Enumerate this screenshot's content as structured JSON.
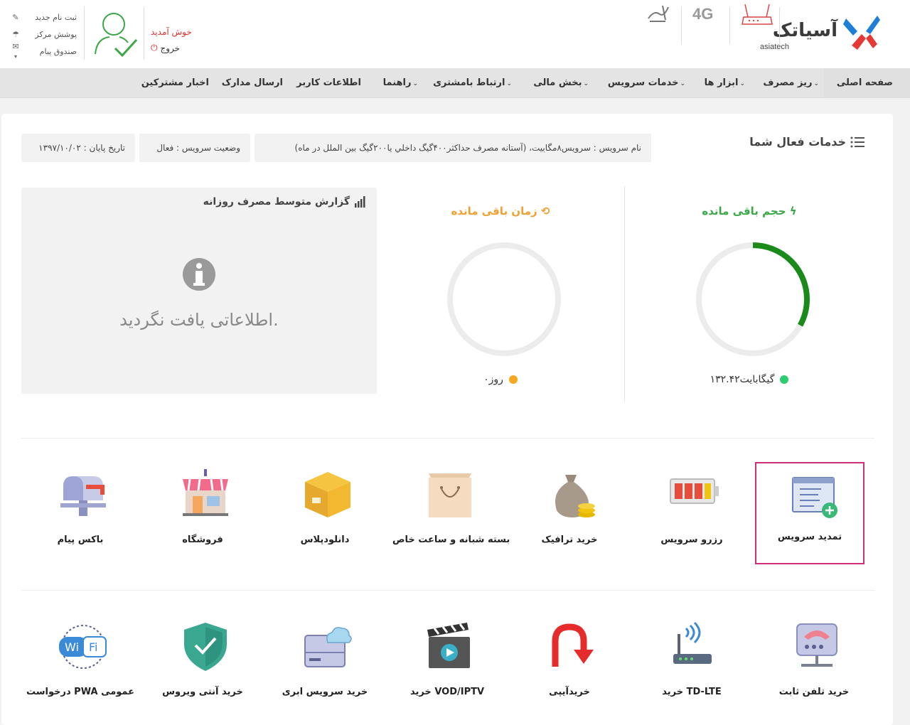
{
  "header": {
    "logo_text": "آسیاتک",
    "logo_sub": "asiatech",
    "welcome": "خوش آمدید",
    "logout": "خروج",
    "quick_links": [
      {
        "label": "ثبت نام جدید",
        "icon": "pencil-icon"
      },
      {
        "label": "پوشش مرکز",
        "icon": "umbrella-icon"
      },
      {
        "label": "صندوق پیام",
        "icon": "envelope-icon"
      }
    ],
    "badge_4g": "4G"
  },
  "nav": {
    "items": [
      {
        "label": "صفحه اصلی",
        "caret": false
      },
      {
        "label": "ریز مصرف",
        "caret": true
      },
      {
        "label": "ابزار ها",
        "caret": true
      },
      {
        "label": "خدمات سرویس",
        "caret": true
      },
      {
        "label": "بخش مالی",
        "caret": true
      },
      {
        "label": "ارتباط بامشتری",
        "caret": true
      },
      {
        "label": "راهنما",
        "caret": true
      },
      {
        "label": "اطلاعات کاربر",
        "caret": false
      },
      {
        "label": "ارسال مدارک",
        "caret": false
      },
      {
        "label": "اخبار مشترکین",
        "caret": false
      }
    ]
  },
  "services": {
    "title": "خدمات فعال شما",
    "service_name": "نام سرویس : سرویس۸مگابیت، (آستانه مصرف حداکثر۴۰۰گیگ داخلي يا۲۰۰گيگ بين الملل در ماه)",
    "status": "وضعیت سرویس : فعال",
    "end_date": "تاریخ پایان : ۱۳۹۷/۱۰/۰۲"
  },
  "gauges": {
    "volume": {
      "title": "حجم باقی مانده",
      "value": "۱۳۲.۴۲گیگابایت",
      "fraction": 0.33,
      "color": "#1a8a1a",
      "dot_color": "#2ecc71"
    },
    "time": {
      "title": "زمان باقی مانده",
      "value": "۰روز",
      "fraction": 0,
      "color": "#f39c12",
      "dot_color": "#f5a623"
    }
  },
  "report": {
    "title": "گزارش متوسط مصرف روزانه",
    "empty": "اطلاعاتی یافت نگردید."
  },
  "tiles_row1": [
    {
      "label": "تمدید سرویس",
      "icon": "renew-service-icon",
      "selected": true
    },
    {
      "label": "رزرو سرویس",
      "icon": "battery-icon",
      "selected": false
    },
    {
      "label": "خرید ترافیک",
      "icon": "money-bag-icon",
      "selected": false
    },
    {
      "label": "بسته شبانه و ساعت خاص",
      "icon": "shopping-bag-icon",
      "selected": false
    },
    {
      "label": "دانلودپلاس",
      "icon": "package-box-icon",
      "selected": false
    },
    {
      "label": "فروشگاه",
      "icon": "shop-icon",
      "selected": false
    },
    {
      "label": "باکس پیام",
      "icon": "mailbox-icon",
      "selected": false
    }
  ],
  "tiles_row2": [
    {
      "label": "خرید تلفن ثابت",
      "icon": "landline-phone-icon"
    },
    {
      "label": "خرید TD-LTE",
      "icon": "lte-router-icon"
    },
    {
      "label": "خریدآیپی",
      "icon": "u-turn-arrow-icon"
    },
    {
      "label": "خرید VOD/IPTV",
      "icon": "clapperboard-icon"
    },
    {
      "label": "خرید سرویس ابری",
      "icon": "cloud-server-icon"
    },
    {
      "label": "خرید آنتی ویروس",
      "icon": "shield-check-icon"
    },
    {
      "label": "درخواست PWA عمومی",
      "icon": "wifi-icon"
    }
  ]
}
